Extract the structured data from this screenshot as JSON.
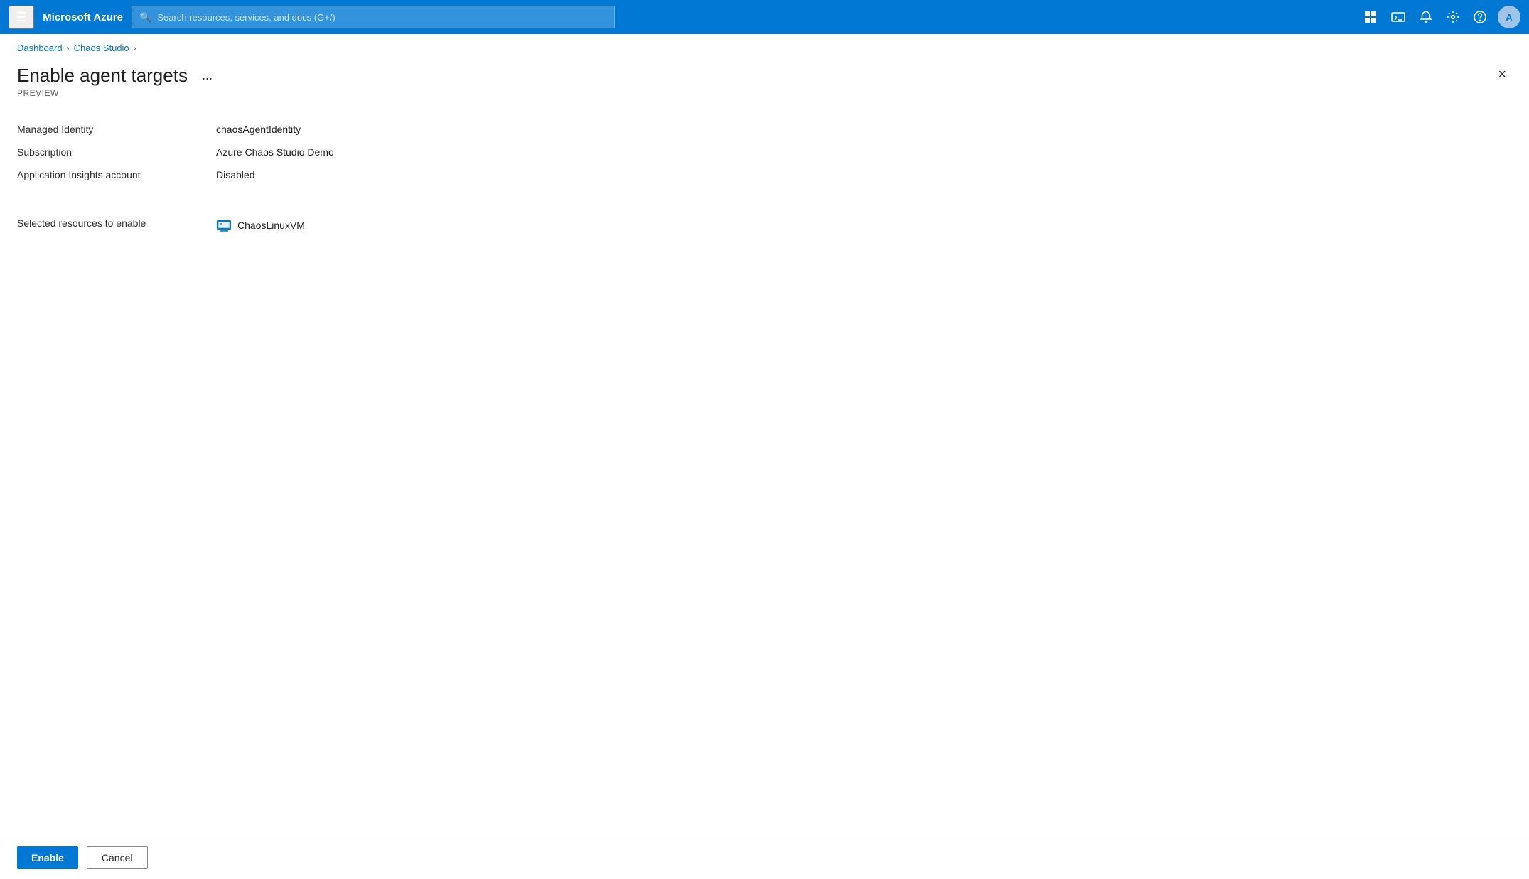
{
  "navbar": {
    "brand": "Microsoft Azure",
    "search_placeholder": "Search resources, services, and docs (G+/)",
    "icons": [
      "grid-icon",
      "cloud-shell-icon",
      "bell-icon",
      "settings-icon",
      "help-icon"
    ]
  },
  "breadcrumb": {
    "items": [
      "Dashboard",
      "Chaos Studio"
    ],
    "separator": "›"
  },
  "panel": {
    "title": "Enable agent targets",
    "subtitle": "PREVIEW",
    "ellipsis": "...",
    "close_label": "×"
  },
  "details": {
    "rows": [
      {
        "label": "Managed Identity",
        "value": "chaosAgentIdentity"
      },
      {
        "label": "Subscription",
        "value": "Azure Chaos Studio Demo"
      },
      {
        "label": "Application Insights account",
        "value": "Disabled"
      }
    ]
  },
  "resources": {
    "label": "Selected resources to enable",
    "items": [
      {
        "name": "ChaosLinuxVM",
        "icon_label": "vm-icon"
      }
    ]
  },
  "footer": {
    "enable_label": "Enable",
    "cancel_label": "Cancel"
  }
}
